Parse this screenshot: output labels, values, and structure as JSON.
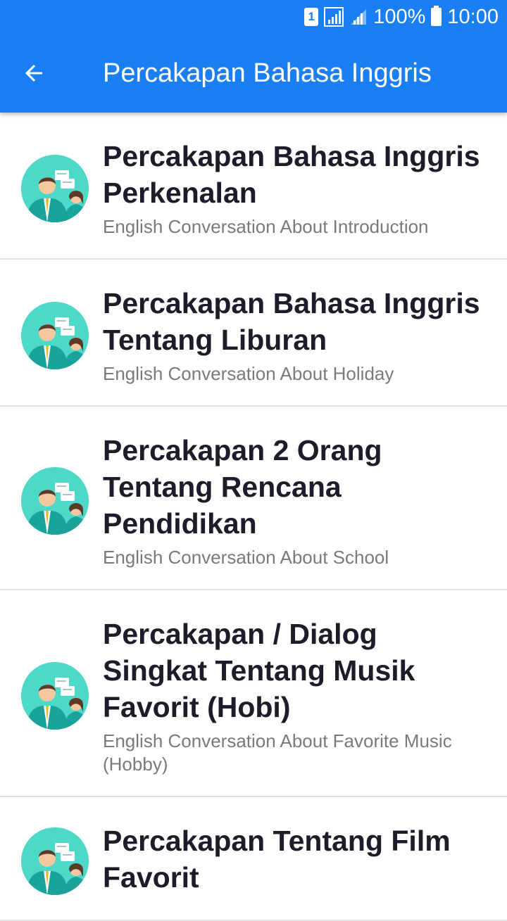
{
  "status_bar": {
    "sim": "1",
    "battery": "100%",
    "time": "10:00"
  },
  "toolbar": {
    "title": "Percakapan Bahasa Inggris",
    "back_icon": "arrow-left-icon"
  },
  "items": [
    {
      "title": "Percakapan Bahasa Inggris Perkenalan",
      "subtitle": "English Conversation About Introduction"
    },
    {
      "title": "Percakapan Bahasa Inggris Tentang Liburan",
      "subtitle": "English Conversation About Holiday"
    },
    {
      "title": "Percakapan 2 Orang Tentang Rencana Pendidikan",
      "subtitle": "English Conversation About School"
    },
    {
      "title": "Percakapan / Dialog Singkat Tentang Musik Favorit (Hobi)",
      "subtitle": "English Conversation About Favorite Music (Hobby)"
    },
    {
      "title": "Percakapan Tentang Film Favorit",
      "subtitle": ""
    }
  ],
  "colors": {
    "primary": "#1a7ff2",
    "avatar_bg": "#4ed8c8",
    "title_text": "#1c1c2a",
    "subtitle_text": "#7a7a7a"
  }
}
